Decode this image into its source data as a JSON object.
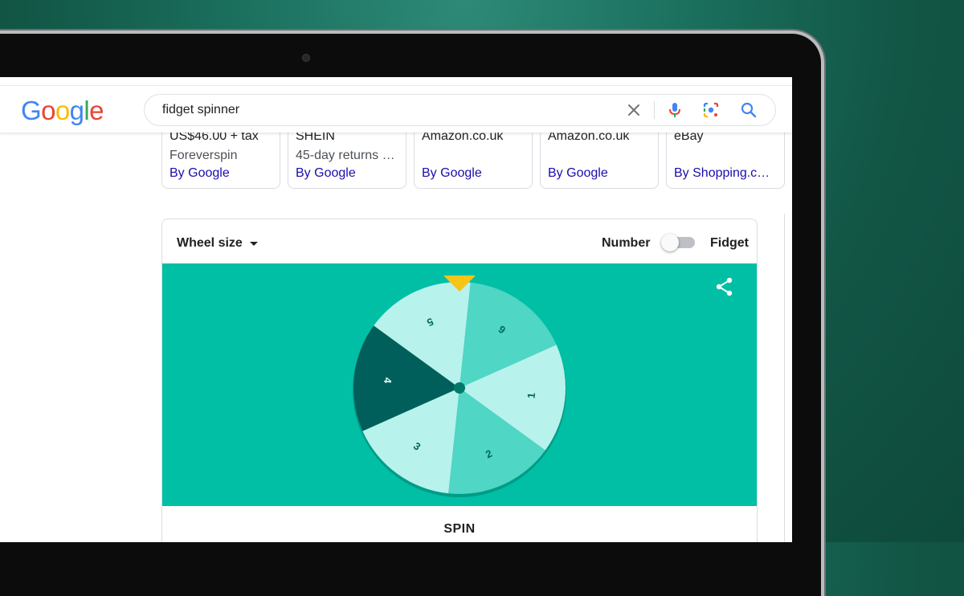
{
  "search": {
    "logo_letters": [
      {
        "ch": "G",
        "color": "#4285F4"
      },
      {
        "ch": "o",
        "color": "#EA4335"
      },
      {
        "ch": "o",
        "color": "#FBBC05"
      },
      {
        "ch": "g",
        "color": "#4285F4"
      },
      {
        "ch": "l",
        "color": "#34A853"
      },
      {
        "ch": "e",
        "color": "#EA4335"
      }
    ],
    "query": "fidget spinner",
    "icons": [
      "close-icon",
      "microphone-icon",
      "google-lens-icon",
      "search-icon"
    ]
  },
  "shopping_cards": [
    {
      "line1": "US$46.00 + tax",
      "line2": "Foreverspin",
      "line3": "By Google"
    },
    {
      "line1": "SHEIN",
      "line2": "45-day returns …",
      "line3": "By Google"
    },
    {
      "line1": "Amazon.co.uk",
      "line2": "",
      "line3": "By Google"
    },
    {
      "line1": "Amazon.co.uk",
      "line2": "",
      "line3": "By Google"
    },
    {
      "line1": "eBay",
      "line2": "",
      "line3": "By Shopping.c…"
    }
  ],
  "spinner": {
    "wheel_size_label": "Wheel size",
    "mode_left": "Number",
    "mode_right": "Fidget",
    "toggle_on": false,
    "spin_label": "SPIN",
    "stage_color": "#00bfa5",
    "pointer_color": "#f5c518",
    "segments": [
      {
        "label": "4",
        "color": "#005f5a"
      },
      {
        "label": "5",
        "color": "#b8f2ec"
      },
      {
        "label": "6",
        "color": "#4fd6c5"
      },
      {
        "label": "1",
        "color": "#b8f2ec"
      },
      {
        "label": "2",
        "color": "#4fd6c5"
      },
      {
        "label": "3",
        "color": "#b8f2ec"
      }
    ],
    "hub_color": "#00796b"
  }
}
